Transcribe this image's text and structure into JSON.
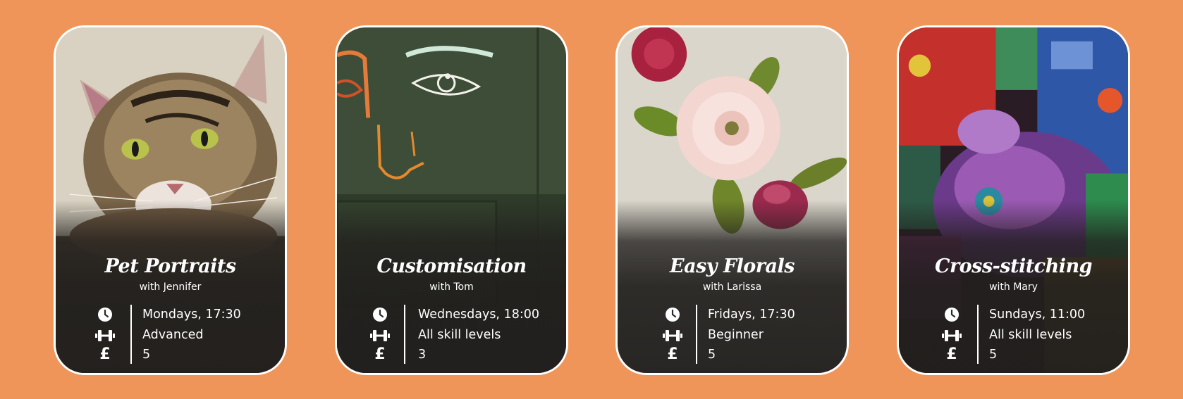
{
  "cards": [
    {
      "title": "Pet Portraits",
      "teacher": "with Jennifer",
      "schedule": "Mondays, 17:30",
      "level": "Advanced",
      "price": "5",
      "image": "embroidered-cat-portrait"
    },
    {
      "title": "Customisation",
      "teacher": "with Tom",
      "schedule": "Wednesdays, 18:00",
      "level": "All skill levels",
      "price": "3",
      "image": "embroidered-face-on-green-jacket"
    },
    {
      "title": "Easy Florals",
      "teacher": "with Larissa",
      "schedule": "Fridays, 17:30",
      "level": "Beginner",
      "price": "5",
      "image": "embroidered-rose-flowers"
    },
    {
      "title": "Cross-stitching",
      "teacher": "with Mary",
      "schedule": "Sundays, 11:00",
      "level": "All skill levels",
      "price": "5",
      "image": "cross-stitch-floral-pattern"
    }
  ],
  "icons": {
    "schedule": "clock-icon",
    "level": "dumbbell-icon",
    "price": "pound-sign-icon"
  },
  "colors": {
    "page_background": "#f0955a",
    "card_border": "#ffffff",
    "card_overlay": "#211f1d"
  }
}
